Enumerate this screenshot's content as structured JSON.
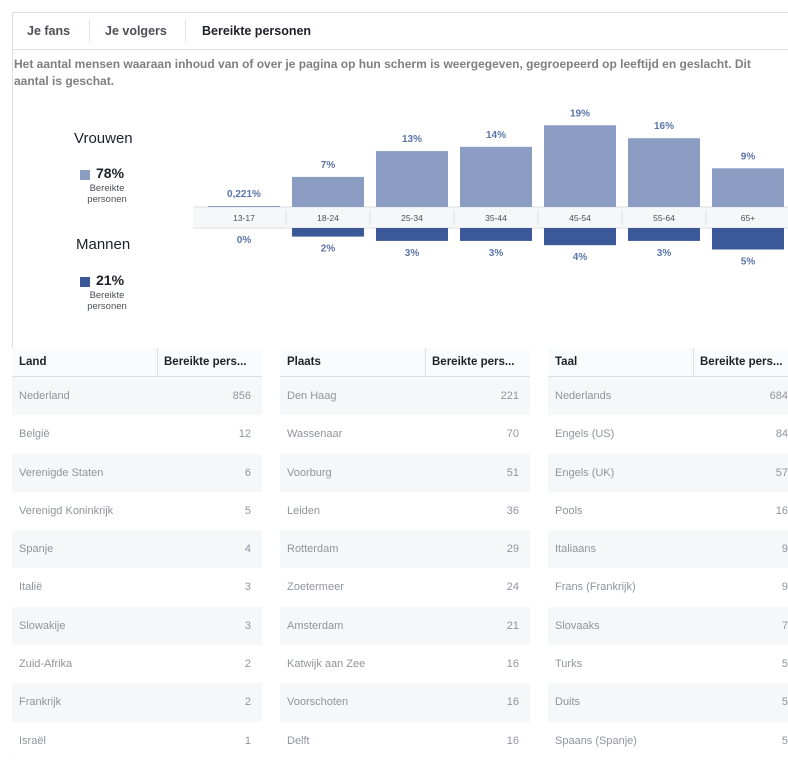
{
  "tabs": [
    {
      "label": "Je fans",
      "active": false
    },
    {
      "label": "Je volgers",
      "active": false
    },
    {
      "label": "Bereikte personen",
      "active": true
    }
  ],
  "description": "Het aantal mensen waaraan inhoud van of over je pagina op hun scherm is weergegeven, gegroepeerd op leeftijd en geslacht. Dit aantal is geschat.",
  "legend": {
    "women": {
      "title": "Vrouwen",
      "pct": "78%",
      "sub": "Bereikte personen",
      "color": "#8b9dc3"
    },
    "men": {
      "title": "Mannen",
      "pct": "21%",
      "sub": "Bereikte personen",
      "color": "#3b5998"
    }
  },
  "chart_data": {
    "type": "bar",
    "categories": [
      "13-17",
      "18-24",
      "25-34",
      "35-44",
      "45-54",
      "55-64",
      "65+"
    ],
    "series": [
      {
        "name": "Vrouwen",
        "values": [
          0.221,
          7,
          13,
          14,
          19,
          16,
          9
        ],
        "labels": [
          "0,221%",
          "7%",
          "13%",
          "14%",
          "19%",
          "16%",
          "9%"
        ],
        "color": "#8b9dc3"
      },
      {
        "name": "Mannen",
        "values": [
          0,
          2,
          3,
          3,
          4,
          3,
          5
        ],
        "labels": [
          "0%",
          "2%",
          "3%",
          "3%",
          "4%",
          "3%",
          "5%"
        ],
        "color": "#3b5998"
      }
    ]
  },
  "tables": [
    {
      "col1": "Land",
      "col2": "Bereikte pers...",
      "rows": [
        [
          "Nederland",
          "856"
        ],
        [
          "België",
          "12"
        ],
        [
          "Verenigde Staten",
          "6"
        ],
        [
          "Verenigd Koninkrijk",
          "5"
        ],
        [
          "Spanje",
          "4"
        ],
        [
          "Italië",
          "3"
        ],
        [
          "Slowakije",
          "3"
        ],
        [
          "Zuid-Afrika",
          "2"
        ],
        [
          "Frankrijk",
          "2"
        ],
        [
          "Israël",
          "1"
        ]
      ]
    },
    {
      "col1": "Plaats",
      "col2": "Bereikte pers...",
      "rows": [
        [
          "Den Haag",
          "221"
        ],
        [
          "Wassenaar",
          "70"
        ],
        [
          "Voorburg",
          "51"
        ],
        [
          "Leiden",
          "36"
        ],
        [
          "Rotterdam",
          "29"
        ],
        [
          "Zoetermeer",
          "24"
        ],
        [
          "Amsterdam",
          "21"
        ],
        [
          "Katwijk aan Zee",
          "16"
        ],
        [
          "Voorschoten",
          "16"
        ],
        [
          "Delft",
          "16"
        ]
      ]
    },
    {
      "col1": "Taal",
      "col2": "Bereikte pers...",
      "rows": [
        [
          "Nederlands",
          "684"
        ],
        [
          "Engels (US)",
          "84"
        ],
        [
          "Engels (UK)",
          "57"
        ],
        [
          "Pools",
          "16"
        ],
        [
          "Italiaans",
          "9"
        ],
        [
          "Frans (Frankrijk)",
          "9"
        ],
        [
          "Slovaaks",
          "7"
        ],
        [
          "Turks",
          "5"
        ],
        [
          "Duits",
          "5"
        ],
        [
          "Spaans (Spanje)",
          "5"
        ]
      ]
    }
  ]
}
